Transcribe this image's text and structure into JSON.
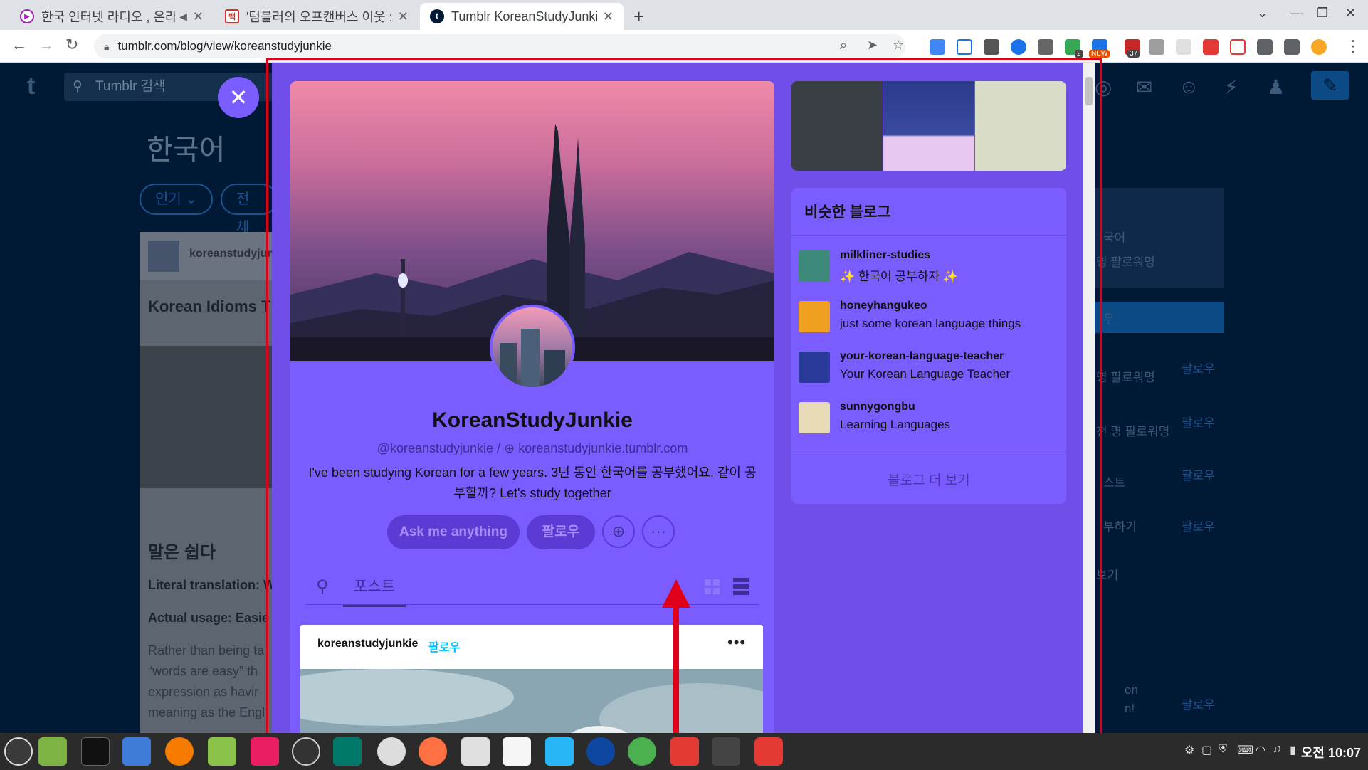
{
  "browser": {
    "tabs": [
      {
        "title": "한국 인터넷 라디오 , 온라",
        "favicon_color": "#9c27b0"
      },
      {
        "title": "'텀블러의 오프캔버스 이웃 :",
        "favicon_color": "#d32f2f"
      },
      {
        "title": "Tumblr KoreanStudyJunkie",
        "favicon_color": "#001935"
      }
    ],
    "new_tab": "+",
    "url": "tumblr.com/blog/view/koreanstudyjunkie",
    "ext_badges": {
      "badge_2": "2",
      "badge_new": "NEW",
      "badge_37": "37"
    }
  },
  "background": {
    "search_placeholder": "Tumblr 검색",
    "heading": "한국어",
    "pill_popular": "인기",
    "pill_all": "전체",
    "post_author": "koreanstudyjun",
    "post_title": "Korean Idioms T Relatable",
    "post_h2": "말은 쉽다",
    "literal": "Literal translation: W",
    "actual": "Actual usage: Easie",
    "body_lines": [
      "Rather than being ta",
      "“words are easy” th",
      "expression as havir",
      "meaning as the Engl"
    ],
    "right_texts": [
      "국어",
      "명 팔로워명",
      "우",
      "명 팔로워명",
      "천 명 팔로워명",
      "스트",
      "부하기",
      "보기",
      "on",
      "n!"
    ],
    "follow": "팔로우"
  },
  "modal": {
    "blog_name": "KoreanStudyJunkie",
    "handle": "@koreanstudyjunkie",
    "separator": "/",
    "domain": "koreanstudyjunkie.tumblr.com",
    "description": "I've been studying Korean for a few years. 3년 동안 한국어를 공부했어요. 같이 공부할까? Let's study together",
    "ask_button": "Ask me anything",
    "follow_button": "팔로우",
    "posts_tab": "포스트",
    "post": {
      "author": "koreanstudyjunkie",
      "follow": "팔로우",
      "menu": "•••"
    },
    "similar": {
      "heading": "비슷한 블로그",
      "blogs": [
        {
          "name": "milkliner-studies",
          "desc": "✨ 한국어 공부하자 ✨",
          "color": "#3d8a7a"
        },
        {
          "name": "honeyhangukeo",
          "desc": "just some korean language things",
          "color": "#f0a020"
        },
        {
          "name": "your-korean-language-teacher",
          "desc": "Your Korean Language Teacher",
          "color": "#2a3a9a"
        },
        {
          "name": "sunnygongbu",
          "desc": "Learning Languages",
          "color": "#e8dcb8"
        }
      ],
      "more": "블로그 더 보기"
    }
  },
  "taskbar": {
    "clock": "오전 10:07"
  },
  "colors": {
    "tumblr_navy": "#001935",
    "modal_purple": "#7b5cff",
    "accent_blue": "#00b8ff",
    "annotation_red": "#e0001a"
  }
}
